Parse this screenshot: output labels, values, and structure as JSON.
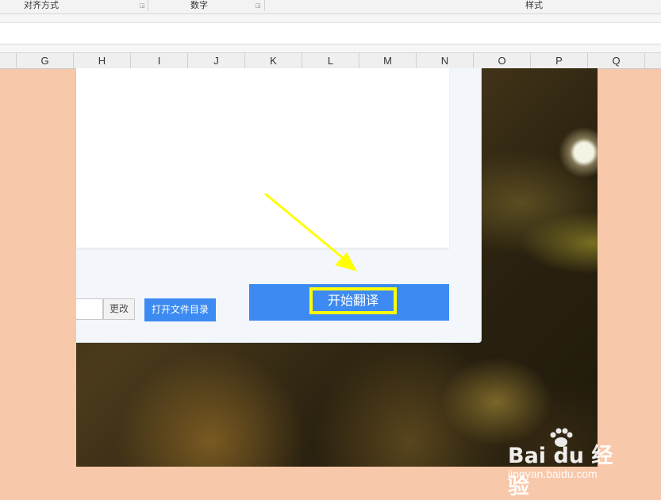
{
  "ribbon": {
    "groups": [
      {
        "label": "对齐方式"
      },
      {
        "label": "数字"
      },
      {
        "label": "样式"
      }
    ],
    "launcher_icon": "dialog-launcher-icon"
  },
  "sheet": {
    "columns": [
      "G",
      "H",
      "I",
      "J",
      "K",
      "L",
      "M",
      "N",
      "O",
      "P",
      "Q"
    ]
  },
  "dialog": {
    "path_input_value": "",
    "change_button": "更改",
    "open_dir_button": "打开文件目录",
    "start_button": "开始翻译"
  },
  "annotation": {
    "arrow_color": "#ffff00",
    "highlight_color": "#ffff00"
  },
  "watermark": {
    "logo": "Bai du 经验",
    "url": "jingyan.baidu.com"
  },
  "colors": {
    "background": "#f8c8aa",
    "button_blue": "#3d8bf2"
  }
}
